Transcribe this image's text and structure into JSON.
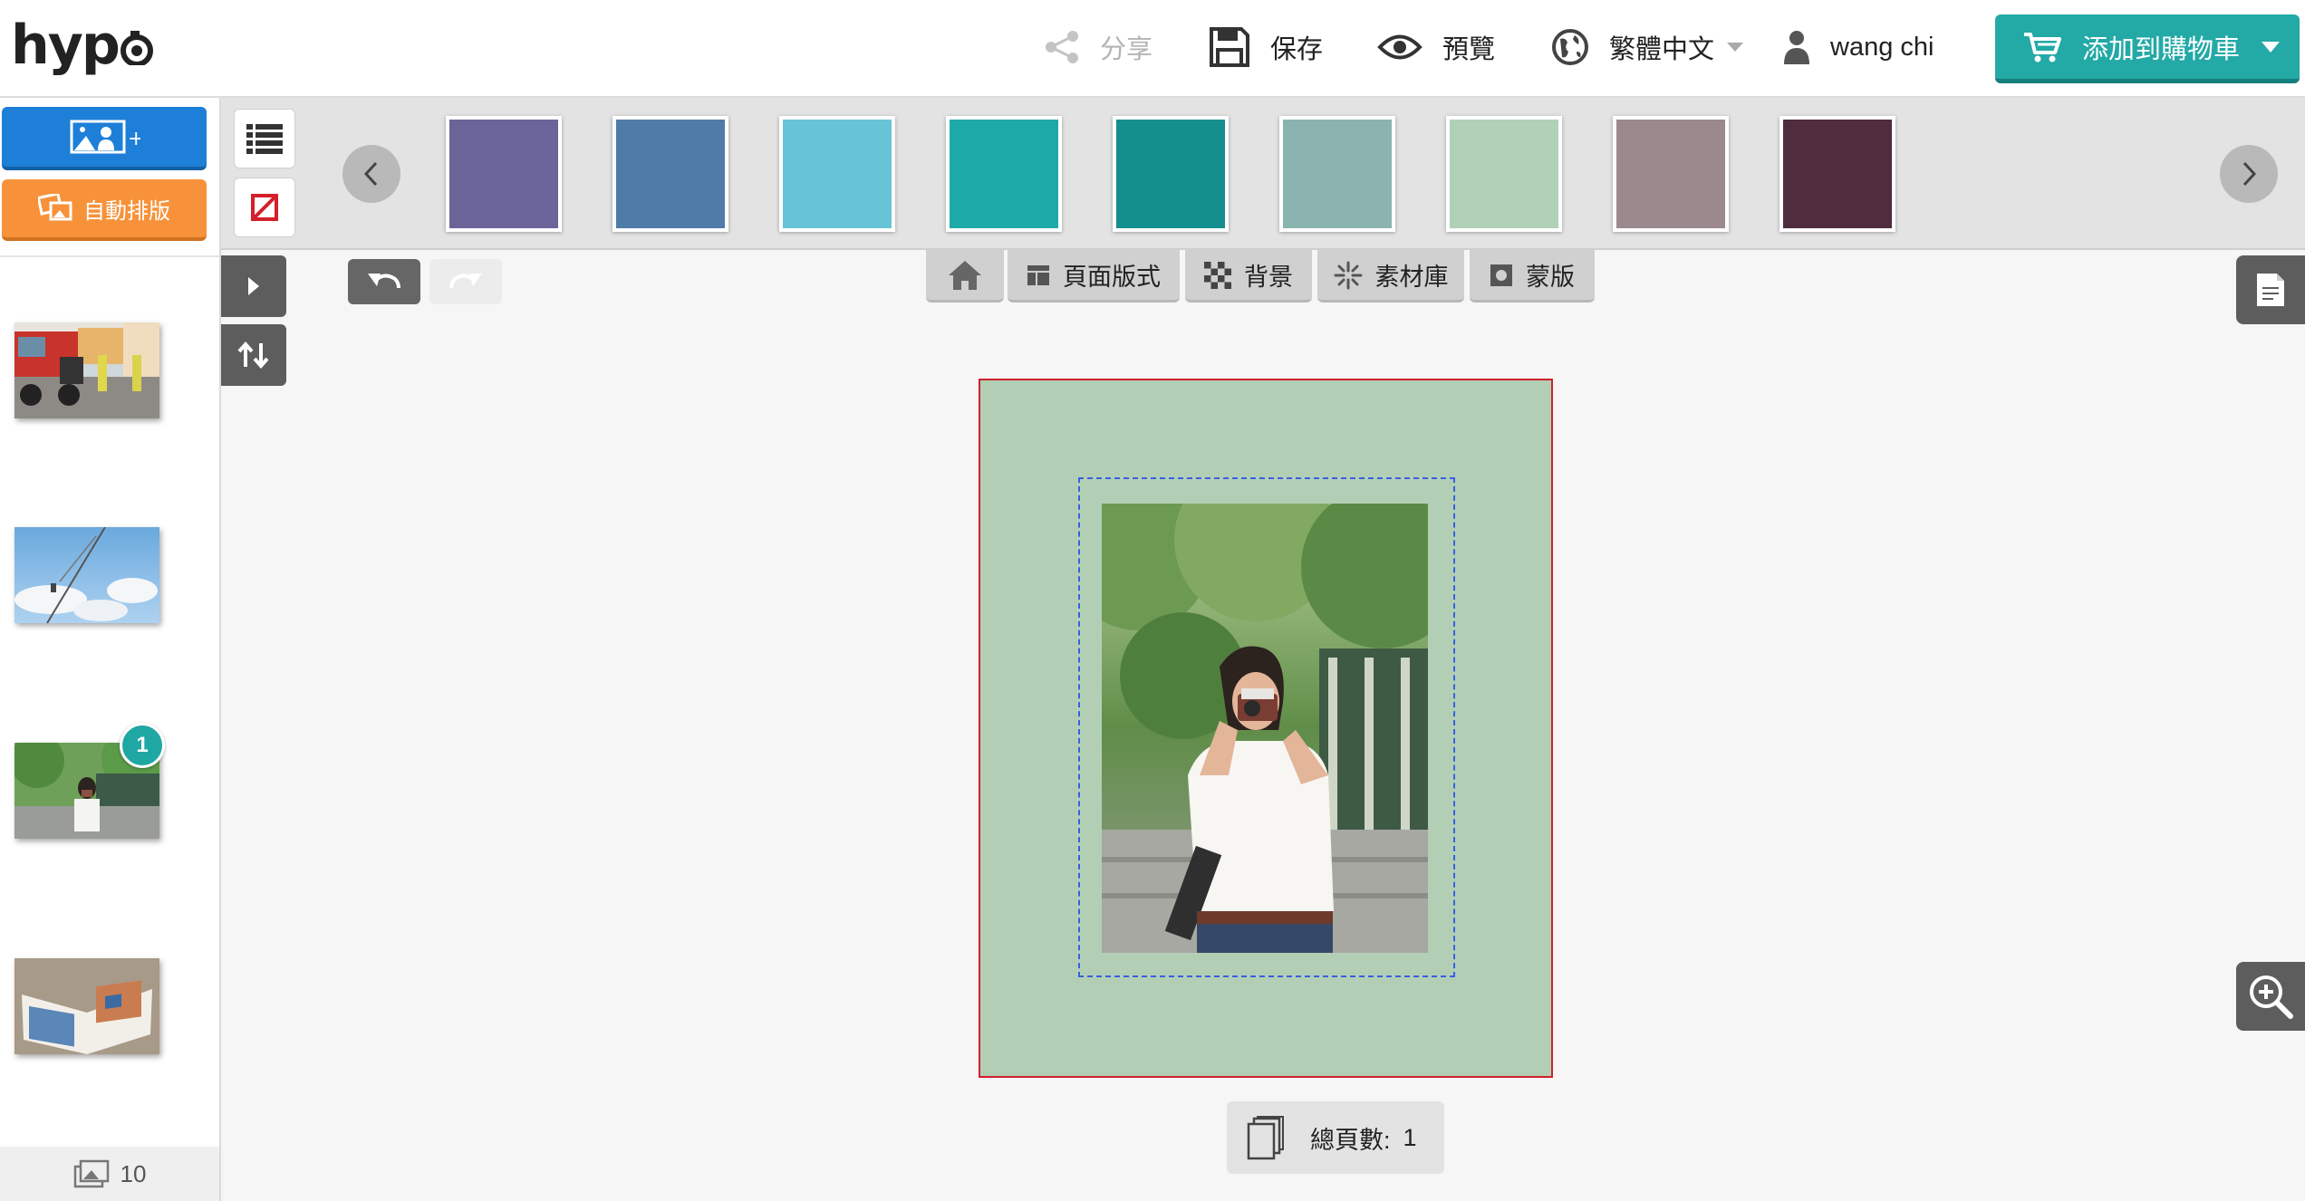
{
  "app": {
    "logo_text": "hyp",
    "logo_o": "o"
  },
  "header": {
    "share_label": "分享",
    "save_label": "保存",
    "preview_label": "預覽",
    "language_label": "繁體中文",
    "user_name": "wang chi",
    "cart_label": "添加到購物車"
  },
  "sidebar": {
    "auto_layout_label": "自動排版",
    "photos": [
      {
        "name": "construction-truck-photo",
        "badge": ""
      },
      {
        "name": "sky-crane-photo",
        "badge": ""
      },
      {
        "name": "woman-camera-photo",
        "badge": "1"
      },
      {
        "name": "open-photobook-photo",
        "badge": ""
      }
    ],
    "photo_count": "10"
  },
  "background_swatches": [
    "#6a6499",
    "#4f7ba9",
    "#67c4d6",
    "#1eaaa9",
    "#148f8e",
    "#8bb4b0",
    "#b0d1b6",
    "#9b898d",
    "#4f2d3e"
  ],
  "tabs": {
    "home_icon": "home-icon",
    "layout_label": "頁面版式",
    "background_label": "背景",
    "materials_label": "素材庫",
    "mask_label": "蒙版"
  },
  "canvas": {
    "page_background": "#b2cfb6",
    "page_border": "#d0202a"
  },
  "footer": {
    "total_pages_label": "總頁數:",
    "total_pages_value": "1"
  },
  "colors": {
    "accent_teal": "#23a9a6",
    "blue_button": "#1d7fd7",
    "orange_button": "#f7923a"
  }
}
